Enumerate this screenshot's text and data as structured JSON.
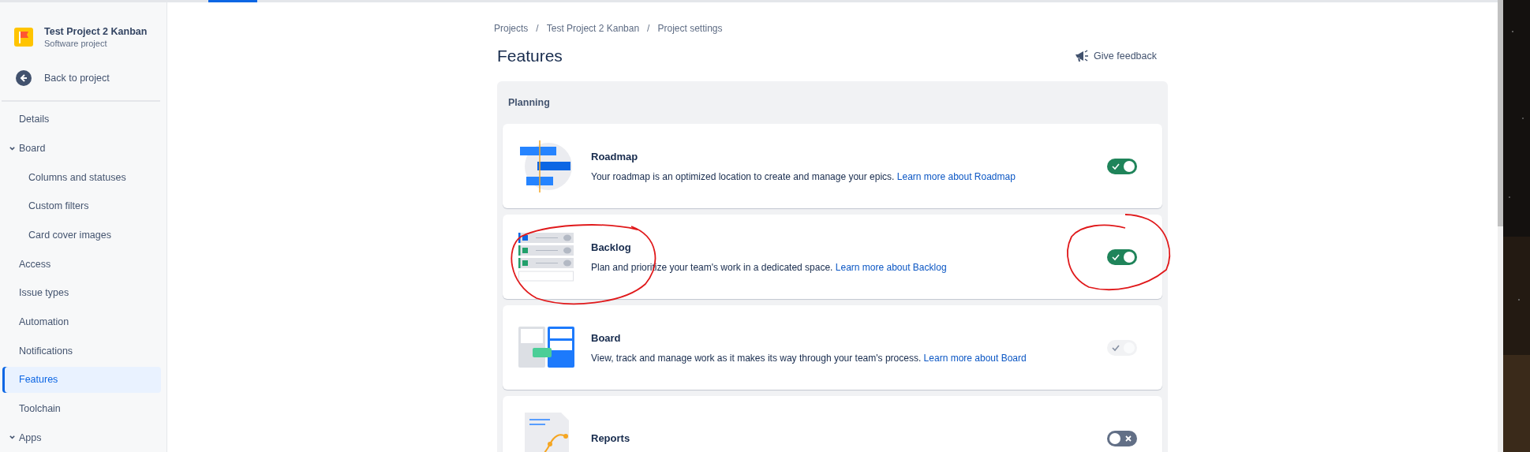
{
  "project": {
    "name": "Test Project 2 Kanban",
    "type": "Software project"
  },
  "back_link": "Back to project",
  "sidebar": {
    "items": [
      {
        "label": "Details",
        "selected": false
      },
      {
        "label": "Board",
        "selected": false,
        "expanded": true,
        "children": [
          {
            "label": "Columns and statuses",
            "selected": false
          },
          {
            "label": "Custom filters",
            "selected": false
          },
          {
            "label": "Card cover images",
            "selected": false
          }
        ]
      },
      {
        "label": "Access",
        "selected": false
      },
      {
        "label": "Issue types",
        "selected": false
      },
      {
        "label": "Automation",
        "selected": false
      },
      {
        "label": "Notifications",
        "selected": false
      },
      {
        "label": "Features",
        "selected": true
      },
      {
        "label": "Toolchain",
        "selected": false
      },
      {
        "label": "Apps",
        "selected": false,
        "expanded": true
      }
    ]
  },
  "breadcrumbs": [
    {
      "kind": "link",
      "text": "Projects"
    },
    {
      "kind": "separator",
      "text": "/"
    },
    {
      "kind": "link",
      "text": "Test Project 2 Kanban"
    },
    {
      "kind": "separator",
      "text": "/"
    },
    {
      "kind": "link",
      "text": "Project settings"
    }
  ],
  "title": "Features",
  "feedback_button": "Give feedback",
  "section": {
    "title": "Planning",
    "features": [
      {
        "kind": "roadmap",
        "name": "Roadmap",
        "description": "Your roadmap is an optimized location to create and manage your epics.",
        "link": "Learn more about Roadmap",
        "on": true,
        "disabled": false
      },
      {
        "kind": "backlog",
        "name": "Backlog",
        "description": "Plan and prioritize your team's work in a dedicated space.",
        "link": "Learn more about Backlog",
        "on": true,
        "disabled": false
      },
      {
        "kind": "board",
        "name": "Board",
        "description": "View, track and manage work as it makes its way through your team's process.",
        "link": "Learn more about Board",
        "on": true,
        "disabled": true
      },
      {
        "kind": "reports",
        "name": "Reports",
        "on": false,
        "disabled": false
      }
    ]
  }
}
